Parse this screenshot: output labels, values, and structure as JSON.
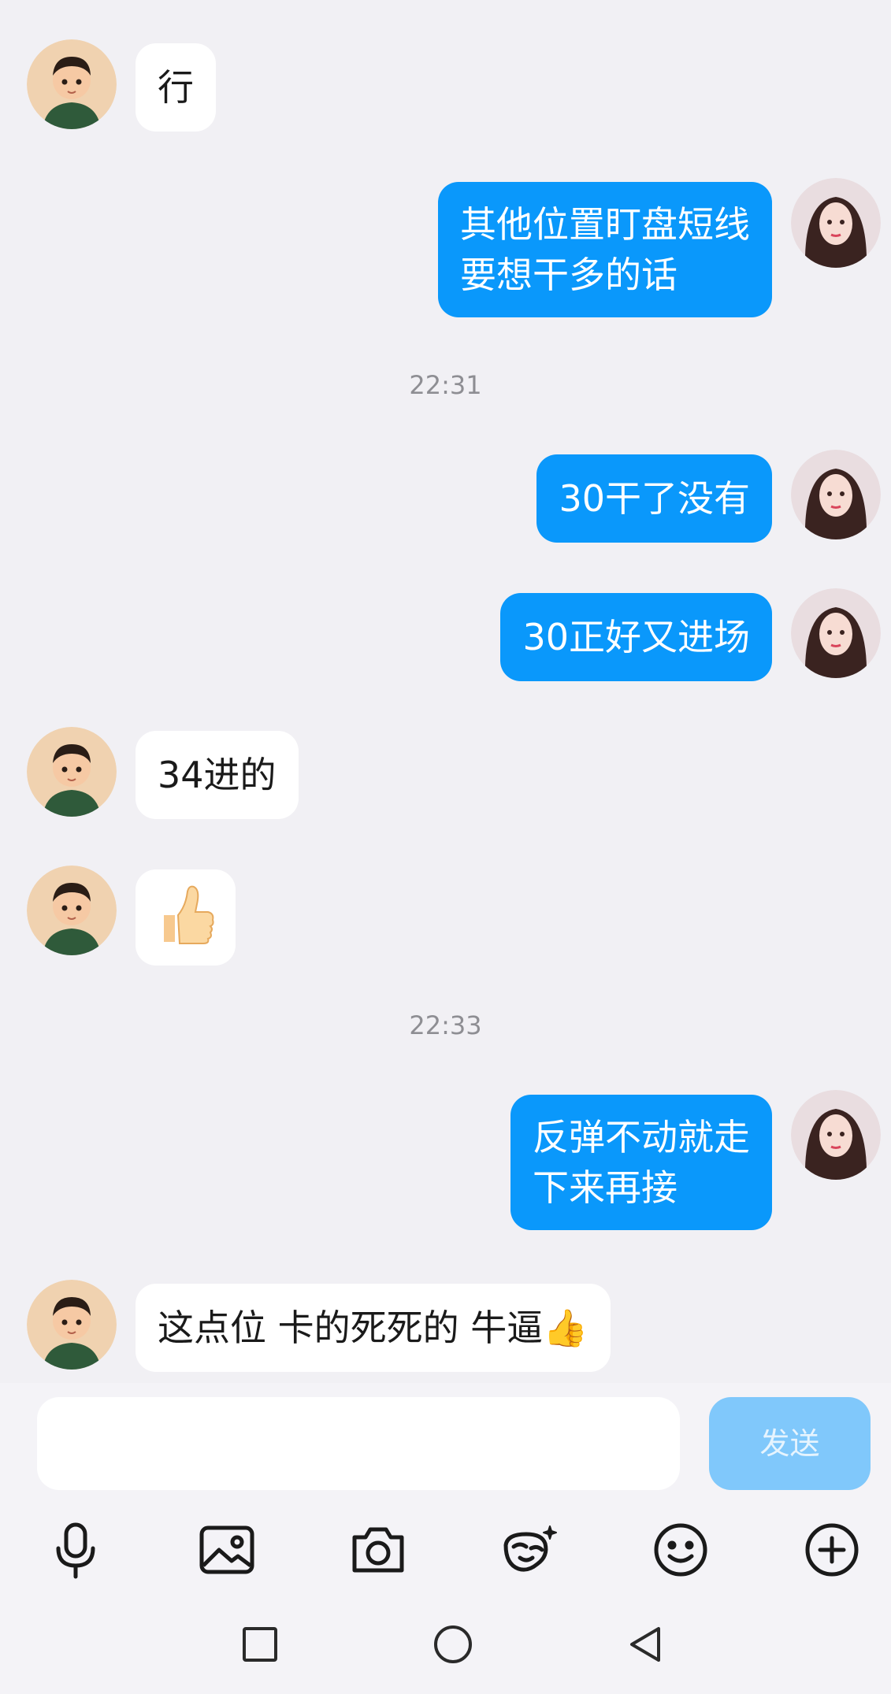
{
  "messages": [
    {
      "side": "in",
      "text": "行"
    },
    {
      "side": "out",
      "text": "其他位置盯盘短线\n要想干多的话"
    },
    {
      "time": "22:31"
    },
    {
      "side": "out",
      "text": "30干了没有"
    },
    {
      "side": "out",
      "text": "30正好又进场"
    },
    {
      "side": "in",
      "text": "34进的"
    },
    {
      "side": "in",
      "text": "👍"
    },
    {
      "time": "22:33"
    },
    {
      "side": "out",
      "text": "反弹不动就走\n下来再接"
    },
    {
      "side": "in",
      "text": "这点位 卡的死死的  牛逼👍"
    }
  ],
  "composer": {
    "input_value": "",
    "send_label": "发送"
  },
  "toolbar_icons": [
    "microphone-icon",
    "image-icon",
    "camera-icon",
    "sticker-icon",
    "emoji-icon",
    "plus-icon"
  ],
  "nav_icons": [
    "recent-apps-icon",
    "home-icon",
    "back-icon"
  ],
  "colors": {
    "outgoing_bubble": "#0a98fb",
    "incoming_bubble": "#ffffff",
    "background": "#f1f0f4",
    "send_disabled": "#80c8fb"
  }
}
